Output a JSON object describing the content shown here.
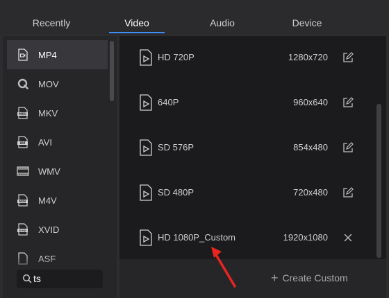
{
  "tabs": [
    {
      "label": "Recently"
    },
    {
      "label": "Video"
    },
    {
      "label": "Audio"
    },
    {
      "label": "Device"
    }
  ],
  "active_tab": "Video",
  "formats": [
    {
      "label": "MP4",
      "icon": "video-file-icon",
      "selected": true
    },
    {
      "label": "MOV",
      "icon": "quicktime-icon"
    },
    {
      "label": "MKV",
      "icon": "mkv-file-icon"
    },
    {
      "label": "AVI",
      "icon": "avi-file-icon"
    },
    {
      "label": "WMV",
      "icon": "film-strip-icon"
    },
    {
      "label": "M4V",
      "icon": "m4v-file-icon"
    },
    {
      "label": "XVID",
      "icon": "xvid-file-icon"
    },
    {
      "label": "ASF",
      "icon": "asf-file-icon"
    }
  ],
  "search": {
    "value": "ts",
    "icon": "search-icon"
  },
  "presets": [
    {
      "name": "HD 720P",
      "resolution": "1280x720",
      "action": "edit-icon"
    },
    {
      "name": "640P",
      "resolution": "960x640",
      "action": "edit-icon"
    },
    {
      "name": "SD 576P",
      "resolution": "854x480",
      "action": "edit-icon"
    },
    {
      "name": "SD 480P",
      "resolution": "720x480",
      "action": "edit-icon"
    },
    {
      "name": "HD 1080P_Custom",
      "resolution": "1920x1080",
      "action": "close-icon"
    }
  ],
  "footer": {
    "create_custom_label": "Create Custom",
    "plus": "+"
  },
  "colors": {
    "accent": "#3e8ef7",
    "annotation_arrow": "#e8251e"
  }
}
